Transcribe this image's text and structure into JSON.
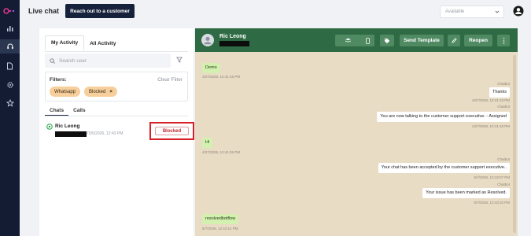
{
  "colors": {
    "rail": "#131c33",
    "header": "#2e6a43",
    "chat_bg": "#e8dcc5",
    "incoming": "#d4f0b0",
    "chip": "#f6cf9c",
    "blocked": "#d61f26"
  },
  "topbar": {
    "title": "Live chat",
    "reach_button": "Reach out to a customer",
    "status": "Available"
  },
  "left": {
    "tabs": [
      "My Activity",
      "All Activity"
    ],
    "search_placeholder": "Search user",
    "filters_label": "Filters:",
    "clear_filter": "Clear Filter",
    "chips": [
      "Whatsapp",
      "Blocked"
    ],
    "chip_remove": "×",
    "subtabs": [
      "Chats",
      "Calls"
    ],
    "conversation": {
      "name": "Ric Leong",
      "date": "7/05/2026, 12:43 PM",
      "status_button": "Blocked"
    }
  },
  "chat": {
    "contact_name": "Ric Leong",
    "send_template": "Send Template",
    "reopen": "Reopen",
    "messages": [
      {
        "text": "Demo",
        "time": "4/27/2026, 12:41:15 PM",
        "sender": ""
      },
      {
        "text": "Thanks",
        "time": "4/27/2026, 12:41:18 PM",
        "sender": "Chatbot"
      },
      {
        "text": "You are now talking to the customer support executive. - Assigned",
        "time": "4/27/2026, 12:41:18 PM",
        "sender": "Chatbot"
      },
      {
        "text": "Hi",
        "time": "4/27/2026, 12:41:26 PM",
        "sender": ""
      },
      {
        "text": "Your chat has been accepted by the customer support executive..",
        "time": "5/7/2026, 12:43:07 PM",
        "sender": "Chatbot"
      },
      {
        "text": "Your issue has been marked as Resolved.",
        "time": "5/7/2026, 12:43:10 PM",
        "sender": "Chatbot"
      },
      {
        "text": "resolvedbotflow",
        "time": "5/7/2026, 12:43:14 PM",
        "sender": ""
      }
    ]
  }
}
